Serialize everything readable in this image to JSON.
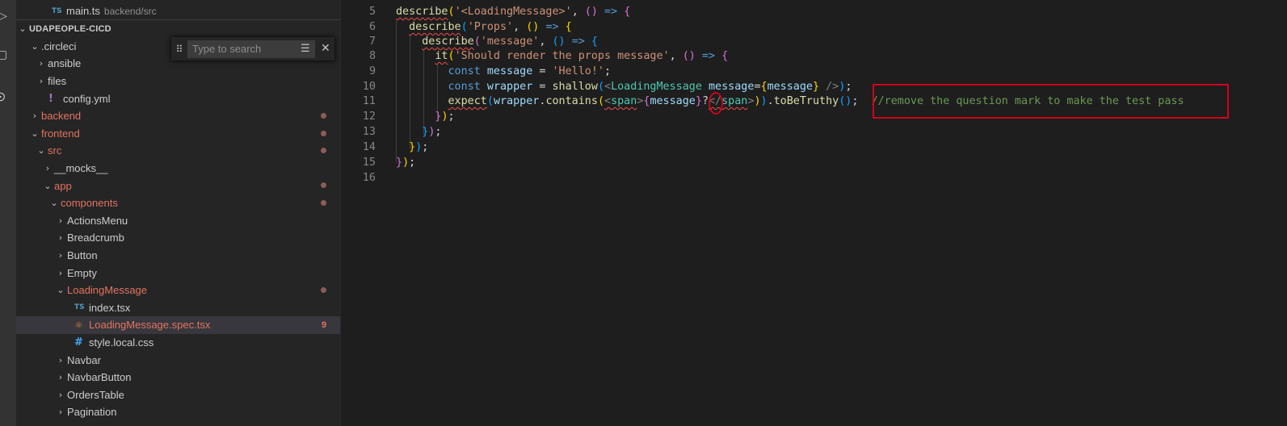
{
  "activity_bar": {
    "icons": [
      "run-debug-icon",
      "extensions-icon",
      "remote-icon"
    ]
  },
  "explorer": {
    "open_editor": {
      "name": "main.ts",
      "path": "backend/src"
    },
    "section_title": "UDAPEOPLE-CICD",
    "items": [
      {
        "label": ".circleci",
        "type": "folder",
        "expanded": true,
        "depth": 0,
        "modified": false
      },
      {
        "label": "ansible",
        "type": "folder",
        "expanded": false,
        "depth": 1,
        "modified": false
      },
      {
        "label": "files",
        "type": "folder",
        "expanded": false,
        "depth": 1,
        "modified": false
      },
      {
        "label": "config.yml",
        "type": "yml",
        "depth": 1,
        "modified": false
      },
      {
        "label": "backend",
        "type": "folder",
        "expanded": false,
        "depth": 0,
        "modified": true
      },
      {
        "label": "frontend",
        "type": "folder",
        "expanded": true,
        "depth": 0,
        "modified": true
      },
      {
        "label": "src",
        "type": "folder",
        "expanded": true,
        "depth": 1,
        "modified": true
      },
      {
        "label": "__mocks__",
        "type": "folder",
        "expanded": false,
        "depth": 2,
        "modified": false
      },
      {
        "label": "app",
        "type": "folder",
        "expanded": true,
        "depth": 2,
        "modified": true
      },
      {
        "label": "components",
        "type": "folder",
        "expanded": true,
        "depth": 3,
        "modified": true
      },
      {
        "label": "ActionsMenu",
        "type": "folder",
        "expanded": false,
        "depth": 4,
        "modified": false
      },
      {
        "label": "Breadcrumb",
        "type": "folder",
        "expanded": false,
        "depth": 4,
        "modified": false
      },
      {
        "label": "Button",
        "type": "folder",
        "expanded": false,
        "depth": 4,
        "modified": false
      },
      {
        "label": "Empty",
        "type": "folder",
        "expanded": false,
        "depth": 4,
        "modified": false
      },
      {
        "label": "LoadingMessage",
        "type": "folder",
        "expanded": true,
        "depth": 4,
        "modified": true
      },
      {
        "label": "index.tsx",
        "type": "ts",
        "depth": 5,
        "modified": false
      },
      {
        "label": "LoadingMessage.spec.tsx",
        "type": "react",
        "depth": 5,
        "modified": true,
        "selected": true,
        "badge": "9"
      },
      {
        "label": "style.local.css",
        "type": "css",
        "depth": 5,
        "modified": false
      },
      {
        "label": "Navbar",
        "type": "folder",
        "expanded": false,
        "depth": 4,
        "modified": false
      },
      {
        "label": "NavbarButton",
        "type": "folder",
        "expanded": false,
        "depth": 4,
        "modified": false
      },
      {
        "label": "OrdersTable",
        "type": "folder",
        "expanded": false,
        "depth": 4,
        "modified": false
      },
      {
        "label": "Pagination",
        "type": "folder",
        "expanded": false,
        "depth": 4,
        "modified": false
      }
    ]
  },
  "find_widget": {
    "placeholder": "Type to search"
  },
  "editor": {
    "line_numbers": [
      "5",
      "6",
      "7",
      "8",
      "9",
      "10",
      "11",
      "12",
      "13",
      "14",
      "15",
      "16"
    ],
    "comment_annotation": "//remove the question mark to make the test pass"
  },
  "colors": {
    "highlight_box": "#d0021b",
    "modified": "#e2735f",
    "background": "#1e1e1e"
  }
}
